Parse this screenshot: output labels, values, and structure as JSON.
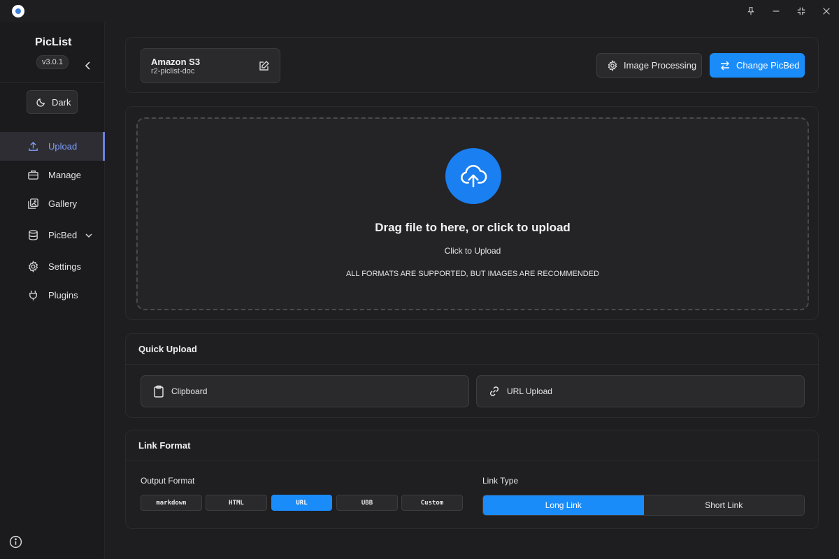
{
  "app": {
    "name": "PicList",
    "version": "v3.0.1"
  },
  "window_controls": {
    "icons": [
      "pin-icon",
      "minimize-icon",
      "restore-icon",
      "close-icon"
    ]
  },
  "sidebar": {
    "theme_label": "Dark",
    "items": [
      {
        "label": "Upload",
        "icon": "upload-icon",
        "active": true
      },
      {
        "label": "Manage",
        "icon": "briefcase-icon",
        "active": false
      },
      {
        "label": "Gallery",
        "icon": "gallery-icon",
        "active": false
      },
      {
        "label": "PicBed",
        "icon": "database-icon",
        "active": false
      },
      {
        "label": "Settings",
        "icon": "gear-icon",
        "active": false
      },
      {
        "label": "Plugins",
        "icon": "plug-icon",
        "active": false
      }
    ]
  },
  "picbed": {
    "name": "Amazon S3",
    "config": "r2-piclist-doc"
  },
  "toolbar": {
    "image_processing_label": "Image Processing",
    "change_picbed_label": "Change PicBed"
  },
  "upload": {
    "title": "Drag file to here, or click to upload",
    "subtitle": "Click to Upload",
    "hint": "ALL FORMATS ARE SUPPORTED, BUT IMAGES ARE RECOMMENDED"
  },
  "quick_upload": {
    "title": "Quick Upload",
    "clipboard_label": "Clipboard",
    "url_label": "URL Upload"
  },
  "link_format": {
    "title": "Link Format",
    "output_format_label": "Output Format",
    "formats": [
      "markdown",
      "HTML",
      "URL",
      "UBB",
      "Custom"
    ],
    "selected_format": "URL",
    "link_type_label": "Link Type",
    "link_types": [
      "Long Link",
      "Short Link"
    ],
    "selected_link_type": "Long Link"
  },
  "colors": {
    "accent": "#1a8cfa",
    "background": "#1e1e20",
    "active_nav": "#7fa0ff"
  }
}
